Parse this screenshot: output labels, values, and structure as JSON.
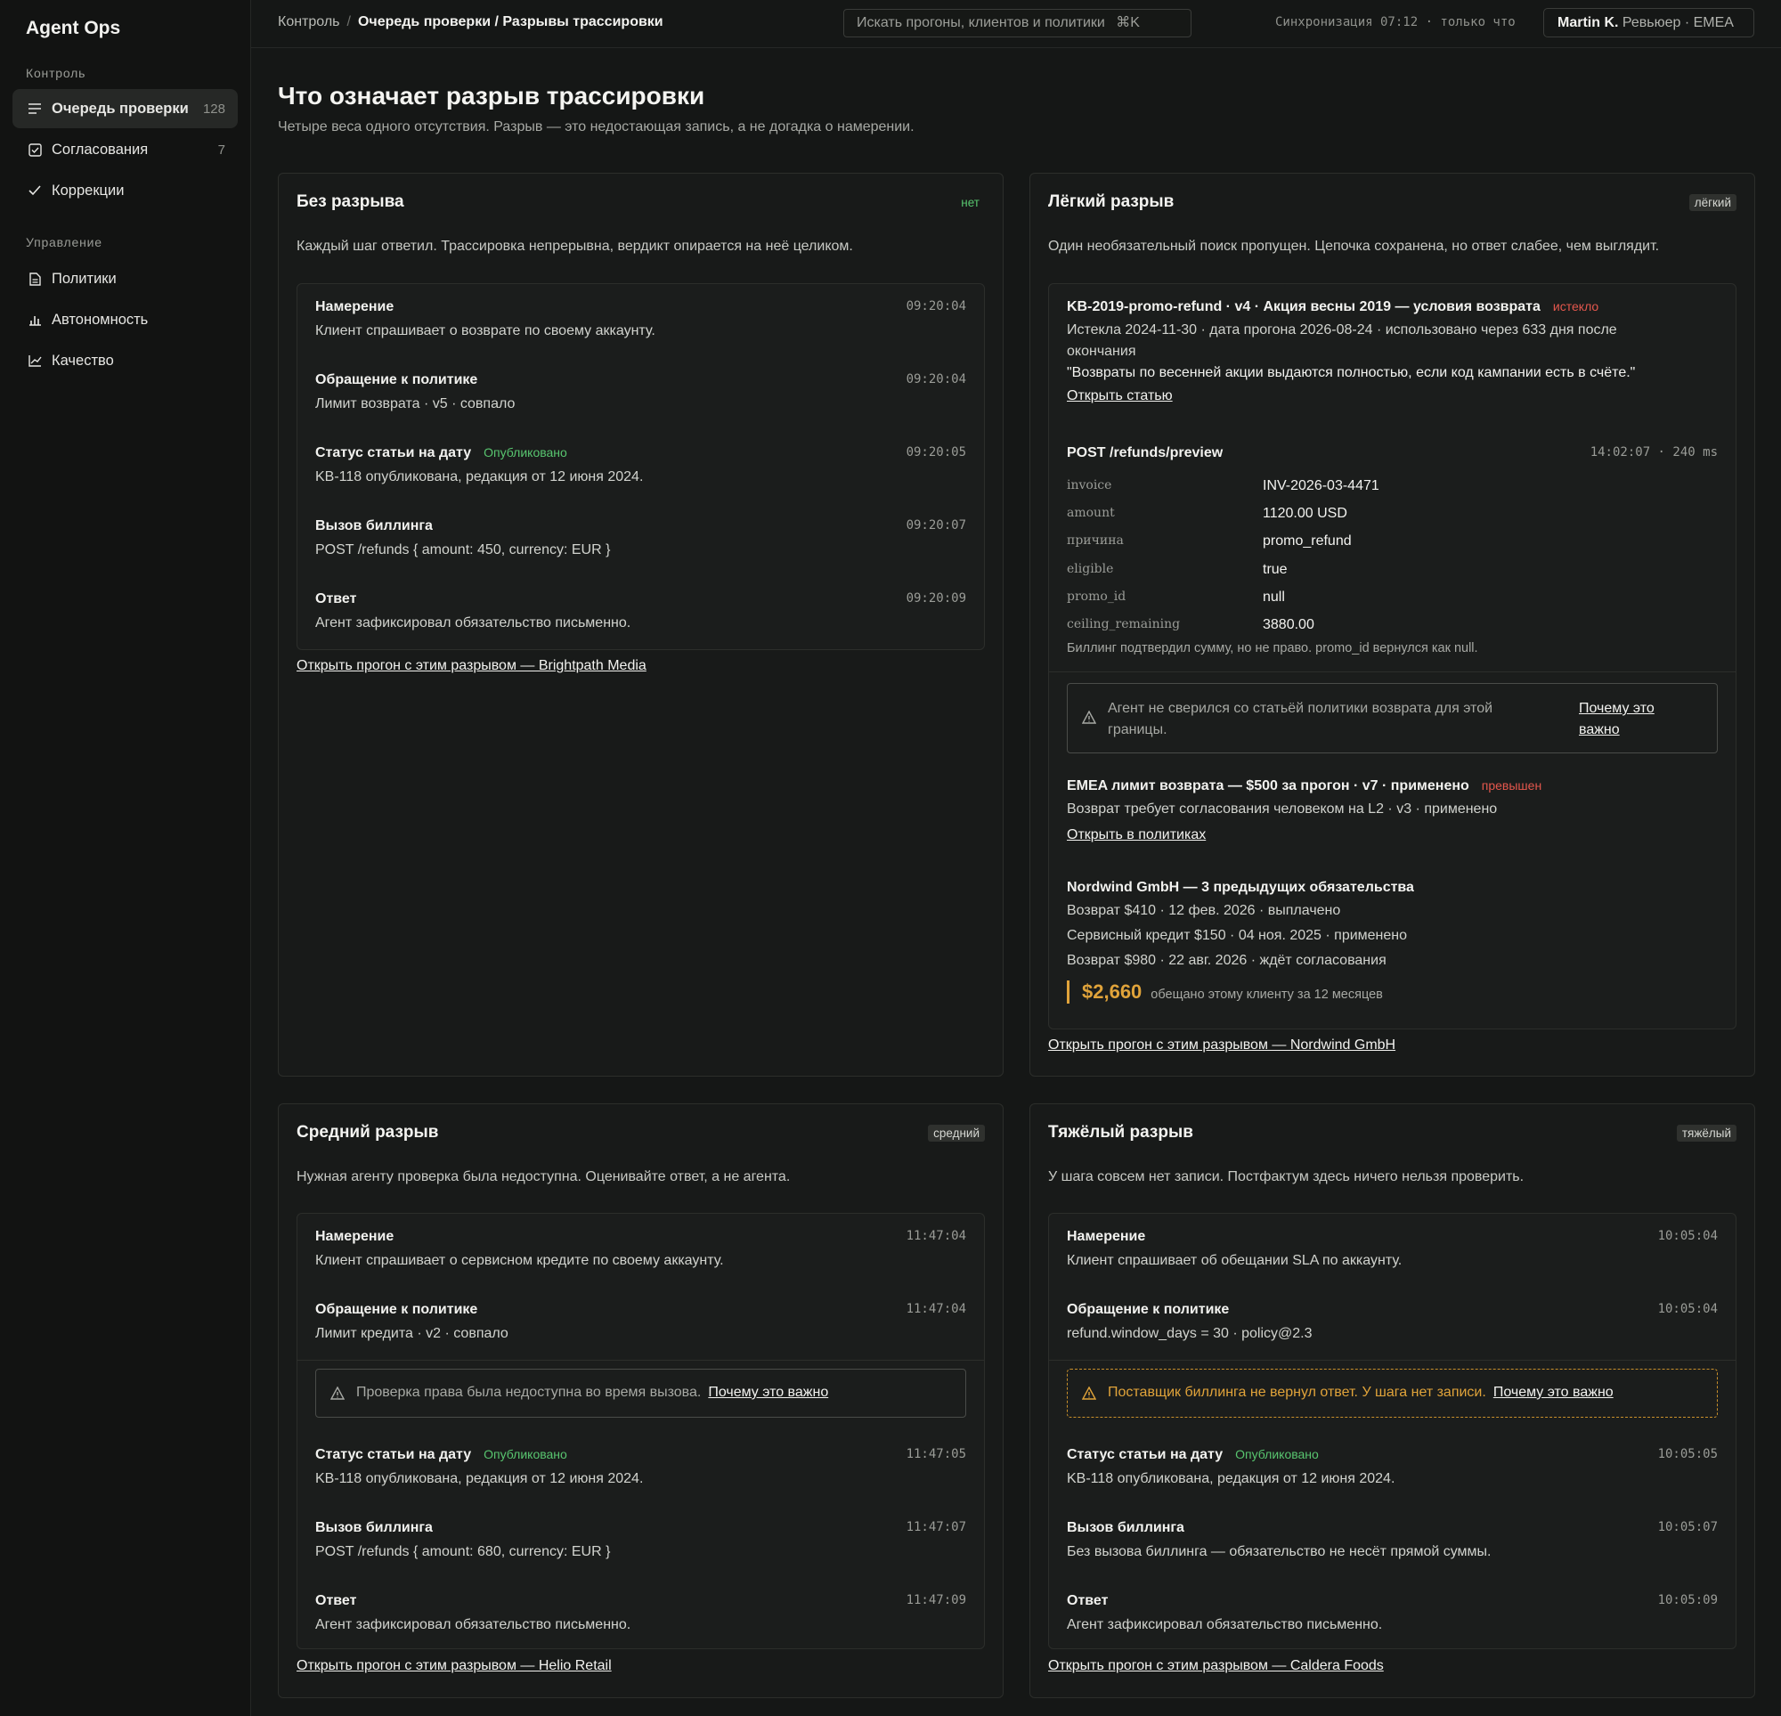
{
  "app": {
    "name": "Agent Ops"
  },
  "sidebar": {
    "section1": "Контроль",
    "section2": "Управление",
    "items": [
      {
        "label": "Очередь проверки",
        "count": "128",
        "icon": "list-icon"
      },
      {
        "label": "Согласования",
        "count": "7",
        "icon": "checkbox-icon"
      },
      {
        "label": "Коррекции",
        "icon": "check-icon"
      },
      {
        "label": "Политики",
        "icon": "document-icon"
      },
      {
        "label": "Автономность",
        "icon": "bar-chart-icon"
      },
      {
        "label": "Качество",
        "icon": "line-chart-icon"
      }
    ]
  },
  "topbar": {
    "crumb_root": "Контроль",
    "crumb_sep": "/",
    "crumb_current": "Очередь проверки / Разрывы трассировки",
    "search_placeholder": "Искать прогоны, клиентов и политики",
    "search_shortcut": "⌘K",
    "sync": "Синхронизация 07:12 · только что",
    "user_name": "Martin K.",
    "user_role": "Ревьюер · EMEA"
  },
  "page": {
    "title": "Что означает разрыв трассировки",
    "subtitle": "Четыре веса одного отсутствия. Разрыв — это недостающая запись, а не догадка о намерении."
  },
  "cards": {
    "none": {
      "title": "Без разрыва",
      "tag": "нет",
      "desc": "Каждый шаг ответил. Трассировка непрерывна, вердикт опирается на неё целиком.",
      "steps": [
        {
          "title": "Намерение",
          "time": "09:20:04",
          "body": "Клиент спрашивает о возврате по своему аккаунту."
        },
        {
          "title": "Обращение к политике",
          "time": "09:20:04",
          "body": "Лимит возврата · v5 · совпало"
        },
        {
          "title": "Статус статьи на дату",
          "badge": "Опубликовано",
          "time": "09:20:05",
          "body": "KB-118 опубликована, редакция от 12 июня 2024."
        },
        {
          "title": "Вызов биллинга",
          "time": "09:20:07",
          "body": "POST /refunds { amount: 450, currency: EUR }"
        },
        {
          "title": "Ответ",
          "time": "09:20:09",
          "body": "Агент зафиксировал обязательство письменно."
        }
      ],
      "link": "Открыть прогон с этим разрывом — Brightpath Media"
    },
    "light": {
      "title": "Лёгкий разрыв",
      "tag": "лёгкий",
      "desc": "Один необязательный поиск пропущен. Цепочка сохранена, но ответ слабее, чем выглядит.",
      "kb_title": "KB-2019-promo-refund · v4 · Акция весны 2019 — условия возврата",
      "kb_status": "истекло",
      "kb_meta": "Истекла 2024-11-30 · дата прогона 2026-08-24 · использовано через 633 дня после окончания",
      "kb_quote": "\"Возвраты по весенней акции выдаются полностью, если код кампании есть в счёте.\"",
      "kb_link": "Открыть статью",
      "api_title": "POST /refunds/preview",
      "api_meta": "14:02:07 · 240 ms",
      "api_rows": [
        {
          "k": "invoice",
          "v": "INV-2026-03-4471"
        },
        {
          "k": "amount",
          "v": "1120.00 USD"
        },
        {
          "k": "причина",
          "v": "promo_refund"
        },
        {
          "k": "eligible",
          "v": "true"
        },
        {
          "k": "promo_id",
          "v": "null"
        },
        {
          "k": "ceiling_remaining",
          "v": "3880.00"
        }
      ],
      "api_note": "Биллинг подтвердил сумму, но не право. promo_id вернулся как null.",
      "warn_text_1": "Агент не сверился со статьёй политики возврата для этой",
      "warn_text_2": "границы.",
      "warn_link_1": "Почему это",
      "warn_link_2": "важно",
      "policy_title": "EMEA лимит возврата — $500 за прогон · v7 · применено",
      "policy_status": "превышен",
      "policy_body": "Возврат требует согласования человеком на L2 · v3 · применено",
      "policy_link": "Открыть в политиках",
      "client_title": "Nordwind GmbH — 3 предыдущих обязательства",
      "client_lines": [
        "Возврат $410 · 12 фев. 2026 · выплачено",
        "Сервисный кредит $150 · 04 ноя. 2025 · применено",
        "Возврат $980 · 22 авг. 2026 · ждёт согласования"
      ],
      "total": "$2,660",
      "total_note": "обещано этому клиенту за 12 месяцев",
      "link": "Открыть прогон с этим разрывом — Nordwind GmbH"
    },
    "medium": {
      "title": "Средний разрыв",
      "tag": "средний",
      "desc": "Нужная агенту проверка была недоступна. Оценивайте ответ, а не агента.",
      "steps": [
        {
          "title": "Намерение",
          "time": "11:47:04",
          "body": "Клиент спрашивает о сервисном кредите по своему аккаунту."
        },
        {
          "title": "Обращение к политике",
          "time": "11:47:04",
          "body": "Лимит кредита · v2 · совпало"
        },
        {
          "title": "Статус статьи на дату",
          "badge": "Опубликовано",
          "time": "11:47:05",
          "body": "KB-118 опубликована, редакция от 12 июня 2024."
        },
        {
          "title": "Вызов биллинга",
          "time": "11:47:07",
          "body": "POST /refunds { amount: 680, currency: EUR }"
        },
        {
          "title": "Ответ",
          "time": "11:47:09",
          "body": "Агент зафиксировал обязательство письменно."
        }
      ],
      "warn_text": "Проверка права была недоступна во время вызова.",
      "warn_link": "Почему это важно",
      "link": "Открыть прогон с этим разрывом — Helio Retail"
    },
    "heavy": {
      "title": "Тяжёлый разрыв",
      "tag": "тяжёлый",
      "desc": "У шага совсем нет записи. Постфактум здесь ничего нельзя проверить.",
      "steps": [
        {
          "title": "Намерение",
          "time": "10:05:04",
          "body": "Клиент спрашивает об обещании SLA по аккаунту."
        },
        {
          "title": "Обращение к политике",
          "time": "10:05:04",
          "body": "refund.window_days = 30 · policy@2.3"
        },
        {
          "title": "Статус статьи на дату",
          "badge": "Опубликовано",
          "time": "10:05:05",
          "body": "KB-118 опубликована, редакция от 12 июня 2024."
        },
        {
          "title": "Вызов биллинга",
          "time": "10:05:07",
          "body": "Без вызова биллинга — обязательство не несёт прямой суммы."
        },
        {
          "title": "Ответ",
          "time": "10:05:09",
          "body": "Агент зафиксировал обязательство письменно."
        }
      ],
      "warn_text": "Поставщик биллинга не вернул ответ. У шага нет записи.",
      "warn_link": "Почему это важно",
      "link": "Открыть прогон с этим разрывом — Caldera Foods"
    }
  },
  "colors": {
    "accent_green": "#58c56f",
    "accent_amber": "#e0a33a",
    "accent_red": "#e4574d",
    "background": "#151716"
  }
}
